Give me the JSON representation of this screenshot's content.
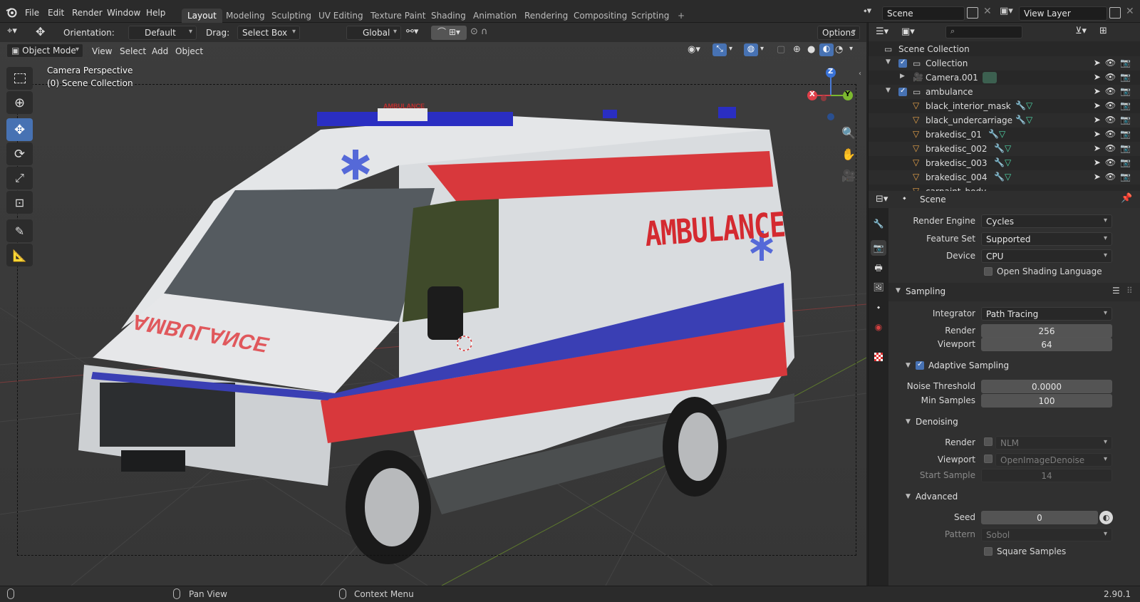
{
  "menu": {
    "file": "File",
    "edit": "Edit",
    "render": "Render",
    "window": "Window",
    "help": "Help"
  },
  "workspaces": [
    "Layout",
    "Modeling",
    "Sculpting",
    "UV Editing",
    "Texture Paint",
    "Shading",
    "Animation",
    "Rendering",
    "Compositing",
    "Scripting"
  ],
  "topbar": {
    "add_workspace": "+",
    "scene": "Scene",
    "view_layer": "View Layer"
  },
  "tool_header": {
    "orientation_label": "Orientation:",
    "orientation_value": "Default",
    "drag_label": "Drag:",
    "drag_value": "Select Box",
    "transform_orientation": "Global",
    "options": "Options"
  },
  "viewport_header": {
    "mode": "Object Mode",
    "view": "View",
    "select": "Select",
    "add": "Add",
    "object": "Object"
  },
  "viewport": {
    "camera_label": "Camera Perspective",
    "collection_label": "(0) Scene Collection",
    "gizmo_x": "X",
    "gizmo_y": "Y",
    "gizmo_z": "Z",
    "van_text_side": "AMBULANCE",
    "van_text_hood": "AMBULANCE",
    "van_lightbar_text": "AMBULANCE"
  },
  "outliner": {
    "root": "Scene Collection",
    "rows": [
      {
        "name": "Collection",
        "type": "collection"
      },
      {
        "name": "Camera.001",
        "type": "camera"
      },
      {
        "name": "ambulance",
        "type": "collection"
      },
      {
        "name": "black_interior_mask",
        "type": "mesh"
      },
      {
        "name": "black_undercarriage",
        "type": "mesh"
      },
      {
        "name": "brakedisc_01",
        "type": "mesh"
      },
      {
        "name": "brakedisc_002",
        "type": "mesh"
      },
      {
        "name": "brakedisc_003",
        "type": "mesh"
      },
      {
        "name": "brakedisc_004",
        "type": "mesh"
      },
      {
        "name": "carpaint_body",
        "type": "mesh"
      }
    ]
  },
  "properties": {
    "context": "Scene",
    "render_engine_label": "Render Engine",
    "render_engine": "Cycles",
    "feature_set_label": "Feature Set",
    "feature_set": "Supported",
    "device_label": "Device",
    "device": "CPU",
    "osl_label": "Open Shading Language",
    "sampling_title": "Sampling",
    "integrator_label": "Integrator",
    "integrator": "Path Tracing",
    "render_label": "Render",
    "render_samples": "256",
    "viewport_label": "Viewport",
    "viewport_samples": "64",
    "adaptive_title": "Adaptive Sampling",
    "noise_threshold_label": "Noise Threshold",
    "noise_threshold": "0.0000",
    "min_samples_label": "Min Samples",
    "min_samples": "100",
    "denoising_title": "Denoising",
    "denoise_render_label": "Render",
    "denoise_render": "NLM",
    "denoise_viewport_label": "Viewport",
    "denoise_viewport": "OpenImageDenoise",
    "start_sample_label": "Start Sample",
    "start_sample": "14",
    "advanced_title": "Advanced",
    "seed_label": "Seed",
    "seed": "0",
    "pattern_label": "Pattern",
    "pattern": "Sobol",
    "square_samples_label": "Square Samples"
  },
  "statusbar": {
    "pan_view": "Pan View",
    "context_menu": "Context Menu",
    "version": "2.90.1"
  },
  "colors": {
    "accent": "#4772b3",
    "van_red": "#d8383c",
    "van_blue": "#3a3fb4"
  }
}
